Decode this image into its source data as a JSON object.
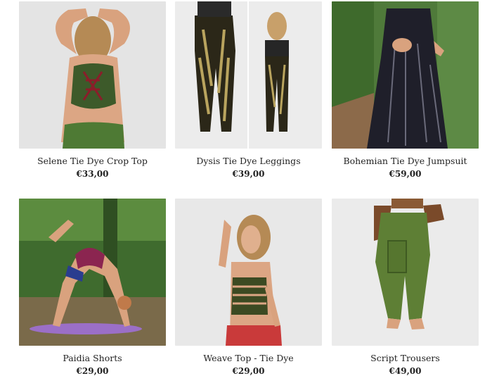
{
  "products": [
    {
      "name": "Selene Tie Dye Crop Top",
      "price": "€33,00"
    },
    {
      "name": "Dysis Tie Dye Leggings",
      "price": "€39,00"
    },
    {
      "name": "Bohemian Tie Dye Jumpsuit",
      "price": "€59,00"
    },
    {
      "name": "Paidia Shorts",
      "price": "€29,00"
    },
    {
      "name": "Weave Top - Tie Dye",
      "price": "€29,00"
    },
    {
      "name": "Script Trousers",
      "price": "€49,00"
    }
  ]
}
